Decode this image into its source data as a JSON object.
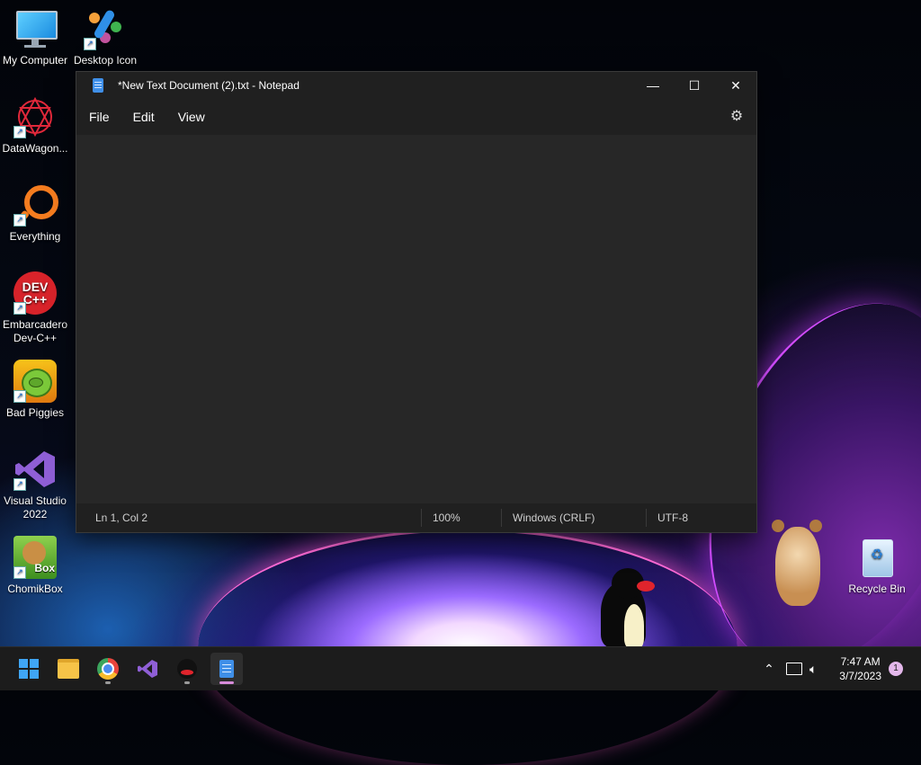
{
  "desktop": {
    "icons": [
      {
        "label": "My Computer",
        "icon": "monitor-icon"
      },
      {
        "label": "Desktop Icon",
        "icon": "desktop-icon-app"
      },
      {
        "label": "DataWagon...",
        "icon": "datawagon-icon"
      },
      {
        "label": "Everything",
        "icon": "magnifier-icon"
      },
      {
        "label": "Embarcadero Dev-C++",
        "icon": "devcpp-icon",
        "badge": "DEV C++"
      },
      {
        "label": "Bad Piggies",
        "icon": "bad-piggies-icon"
      },
      {
        "label": "Visual Studio 2022",
        "icon": "visual-studio-icon"
      },
      {
        "label": "ChomikBox",
        "icon": "chomikbox-icon",
        "badge": "Box"
      },
      {
        "label": "Recycle Bin",
        "icon": "recycle-bin-icon"
      }
    ]
  },
  "notepad": {
    "title": "*New Text Document (2).txt - Notepad",
    "menu": [
      "File",
      "Edit",
      "View"
    ],
    "controls": {
      "minimize": "—",
      "maximize": "☐",
      "close": "✕"
    },
    "settings_icon": "gear-icon",
    "editor_text": "",
    "status": {
      "position": "Ln 1, Col 2",
      "zoom": "100%",
      "line_ending": "Windows (CRLF)",
      "encoding": "UTF-8"
    }
  },
  "taskbar": {
    "apps": [
      {
        "name": "Start",
        "icon": "windows-start-icon"
      },
      {
        "name": "File Explorer",
        "icon": "folder-icon"
      },
      {
        "name": "Chrome",
        "icon": "chrome-icon"
      },
      {
        "name": "Visual Studio",
        "icon": "visual-studio-icon"
      },
      {
        "name": "Pingu",
        "icon": "pingu-icon"
      },
      {
        "name": "Notepad",
        "icon": "notepad-icon"
      }
    ],
    "tray": {
      "time": "7:47 AM",
      "date": "3/7/2023",
      "notifications": "1"
    }
  },
  "colors": {
    "window_bg": "#202020",
    "editor_bg": "#272727",
    "taskbar_bg": "#1c1c1c",
    "accent": "#d78bd9"
  }
}
